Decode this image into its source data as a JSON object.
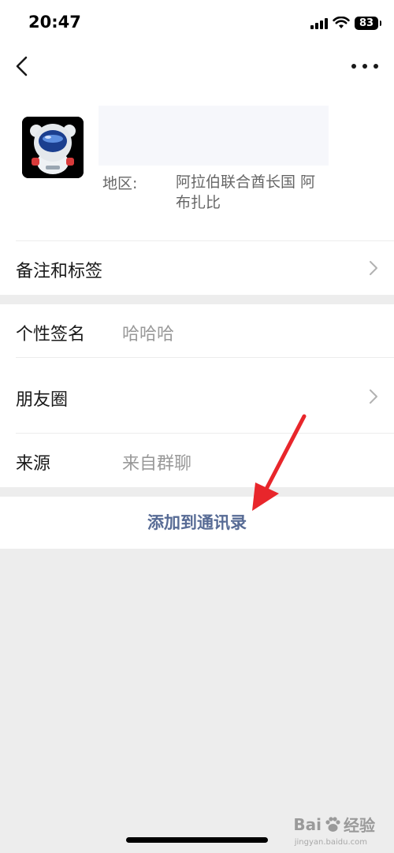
{
  "status_bar": {
    "time": "20:47",
    "battery": "83"
  },
  "nav": {
    "back_icon": "chevron-left-icon",
    "more_icon": "more-dots-icon"
  },
  "profile": {
    "region_label": "地区:",
    "region_value": "阿拉伯联合酋长国 阿布扎比"
  },
  "rows": {
    "remark_tags_label": "备注和标签",
    "signature_label": "个性签名",
    "signature_value": "哈哈哈",
    "moments_label": "朋友圈",
    "source_label": "来源",
    "source_value": "来自群聊"
  },
  "action": {
    "add_to_contacts": "添加到通讯录"
  },
  "watermark": {
    "brand": "Bai",
    "brand_cn": "经验",
    "url": "jingyan.baidu.com"
  },
  "colors": {
    "accent": "#576b95",
    "background": "#ededed",
    "annotation_arrow": "#e8262b"
  }
}
